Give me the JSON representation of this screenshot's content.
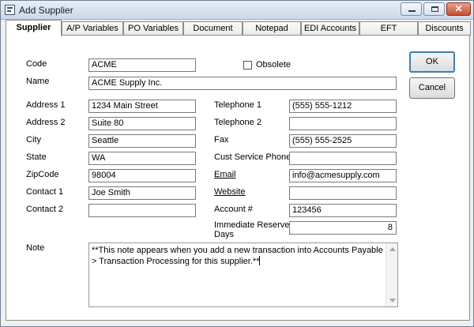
{
  "window": {
    "title": "Add Supplier"
  },
  "tabs": [
    {
      "label": "Supplier"
    },
    {
      "label": "A/P Variables"
    },
    {
      "label": "PO Variables"
    },
    {
      "label": "Document"
    },
    {
      "label": "Notepad"
    },
    {
      "label": "EDI Accounts"
    },
    {
      "label": "EFT"
    },
    {
      "label": "Discounts"
    }
  ],
  "form": {
    "code": {
      "label": "Code",
      "value": "ACME"
    },
    "obsolete": {
      "label": "Obsolete",
      "checked": false
    },
    "name": {
      "label": "Name",
      "value": "ACME Supply Inc."
    },
    "address1": {
      "label": "Address 1",
      "value": "1234 Main Street"
    },
    "address2": {
      "label": "Address 2",
      "value": "Suite 80"
    },
    "city": {
      "label": "City",
      "value": "Seattle"
    },
    "state": {
      "label": "State",
      "value": "WA"
    },
    "zipcode": {
      "label": "ZipCode",
      "value": "98004"
    },
    "contact1": {
      "label": "Contact 1",
      "value": "Joe Smith"
    },
    "contact2": {
      "label": "Contact 2",
      "value": ""
    },
    "telephone1": {
      "label": "Telephone 1",
      "value": "(555) 555-1212"
    },
    "telephone2": {
      "label": "Telephone 2",
      "value": ""
    },
    "fax": {
      "label": "Fax",
      "value": "(555) 555-2525"
    },
    "cust_service_phone": {
      "label": "Cust Service Phone",
      "value": ""
    },
    "email": {
      "label": "Email",
      "value": "info@acmesupply.com"
    },
    "website": {
      "label": "Website",
      "value": ""
    },
    "account": {
      "label": "Account #",
      "value": "123456"
    },
    "reserved_days": {
      "label_line1": "Immediate Reserved",
      "label_line2": "Days",
      "value": "8"
    },
    "note": {
      "label": "Note",
      "value": "**This note appears when you add a new transaction into Accounts Payable > Transaction Processing for this supplier.**"
    }
  },
  "buttons": {
    "ok": "OK",
    "cancel": "Cancel"
  }
}
